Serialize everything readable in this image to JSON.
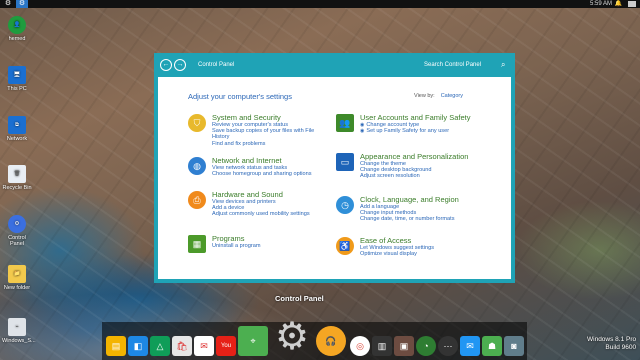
{
  "topbar": {
    "clock": "5:59 AM"
  },
  "desktop": {
    "icons": [
      {
        "label": "hemed"
      },
      {
        "label": "This PC"
      },
      {
        "label": "Network"
      },
      {
        "label": "Recycle Bin"
      },
      {
        "label": "Control Panel"
      },
      {
        "label": "New folder"
      },
      {
        "label": "Windows_S..."
      }
    ]
  },
  "window": {
    "address": "Control Panel",
    "search_placeholder": "Search Control Panel",
    "heading": "Adjust your computer's settings",
    "viewby_label": "View by:",
    "viewby_value": "Category",
    "categories": [
      {
        "title": "System and Security",
        "icon": "shield-icon",
        "color": "#e8b92c",
        "links": [
          "Review your computer's status",
          "Save backup copies of your files with File History",
          "Find and fix problems"
        ]
      },
      {
        "title": "Network and Internet",
        "icon": "globe-icon",
        "color": "#2f7fd1",
        "links": [
          "View network status and tasks",
          "Choose homegroup and sharing options"
        ]
      },
      {
        "title": "Hardware and Sound",
        "icon": "printer-icon",
        "color": "#f08a1c",
        "links": [
          "View devices and printers",
          "Add a device",
          "Adjust commonly used mobility settings"
        ]
      },
      {
        "title": "Programs",
        "icon": "apps-icon",
        "color": "#4c9a2a",
        "links": [
          "Uninstall a program"
        ]
      },
      {
        "title": "User Accounts and Family Safety",
        "icon": "users-icon",
        "color": "#3e8a2a",
        "links": [
          "Change account type",
          "Set up Family Safety for any user"
        ]
      },
      {
        "title": "Appearance and Personalization",
        "icon": "monitor-icon",
        "color": "#1e64b8",
        "links": [
          "Change the theme",
          "Change desktop background",
          "Adjust screen resolution"
        ]
      },
      {
        "title": "Clock, Language, and Region",
        "icon": "clock-icon",
        "color": "#2f8fd8",
        "links": [
          "Add a language",
          "Change input methods",
          "Change date, time, or number formats"
        ]
      },
      {
        "title": "Ease of Access",
        "icon": "accessibility-icon",
        "color": "#f09a1a",
        "links": [
          "Let Windows suggest settings",
          "Optimize visual display"
        ]
      }
    ]
  },
  "dock": {
    "tooltip": "Control Panel"
  },
  "watermark": {
    "line1": "Windows 8.1 Pro",
    "line2": "Build 9600"
  }
}
